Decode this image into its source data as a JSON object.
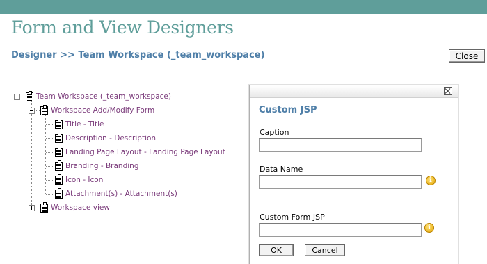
{
  "page": {
    "title": "Form and View Designers",
    "breadcrumb": "Designer >> Team Workspace (_team_workspace)",
    "close_label": "Close"
  },
  "tree": {
    "root": "Team Workspace (_team_workspace)",
    "form": "Workspace Add/Modify Form",
    "fields": [
      "Title - Title",
      "Description - Description",
      "Landing Page Layout - Landing Page Layout",
      "Branding - Branding",
      "Icon - Icon",
      "Attachment(s) - Attachment(s)"
    ],
    "view": "Workspace view"
  },
  "dialog": {
    "heading": "Custom JSP",
    "caption_label": "Caption",
    "caption_value": "",
    "dataname_label": "Data Name",
    "dataname_value": "",
    "jsp_label": "Custom Form JSP",
    "jsp_value": "",
    "info_glyph": "i",
    "ok_label": "OK",
    "cancel_label": "Cancel"
  },
  "colors": {
    "topbar": "#5f9e9a",
    "title": "#5f9e9a",
    "link_blue": "#4f7fa8",
    "tree_text": "#7a3a7a"
  }
}
